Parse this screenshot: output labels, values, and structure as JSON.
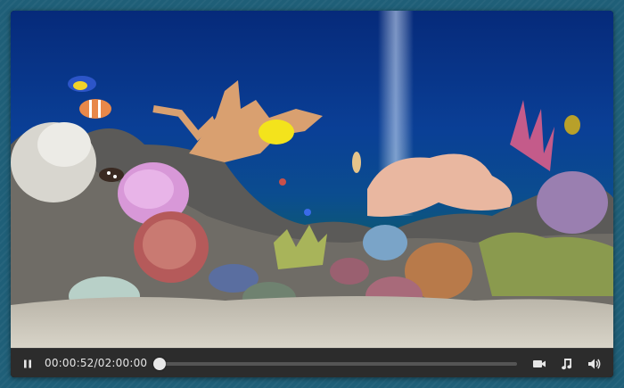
{
  "player": {
    "current_time": "00:00:52",
    "duration": "02:00:00",
    "progress_fraction": 0.0072,
    "icons": {
      "play_pause": "pause-icon",
      "video": "video-camera-icon",
      "audio": "music-note-icon",
      "volume": "volume-icon"
    }
  },
  "colors": {
    "controls_background": "#2c2c2c",
    "desktop_background": "#1f5f78"
  }
}
